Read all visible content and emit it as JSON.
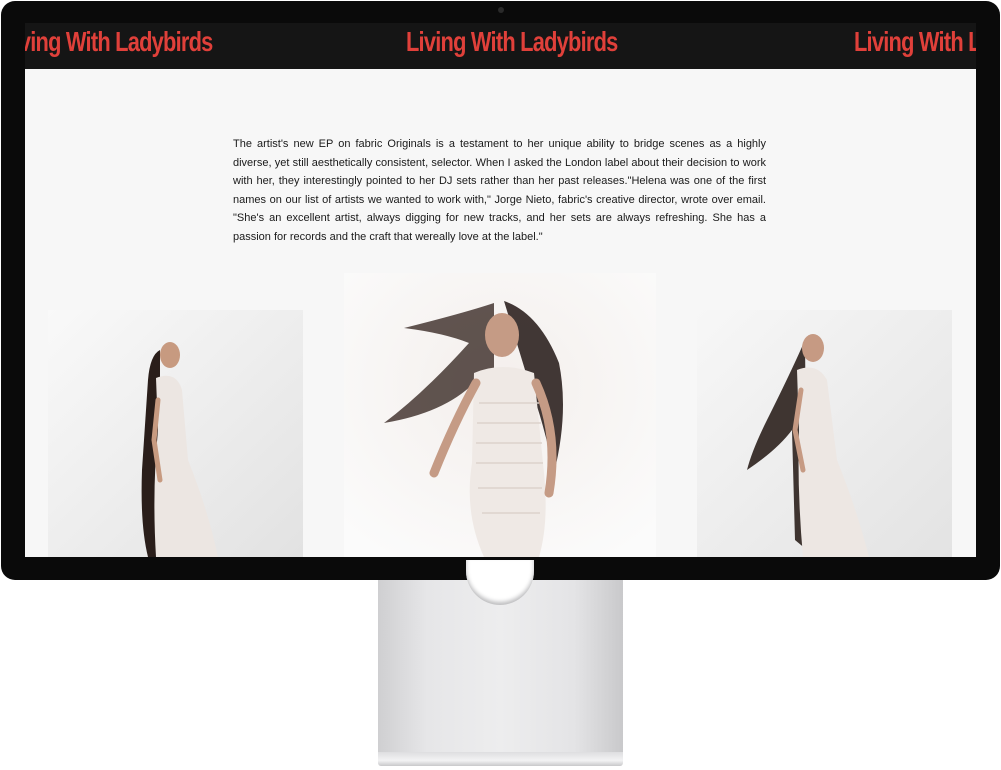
{
  "banner": {
    "items": [
      "Living With Ladybirds",
      "Living With Ladybirds",
      "Living With Ladybirds"
    ],
    "text_color": "#e0403a",
    "background": "#151515"
  },
  "article": {
    "paragraph": "The artist's new EP on fabric Originals is a testament to her unique ability to bridge scenes as a highly diverse, yet still aesthetically consistent, selector. When I asked the London label about their decision to work with her, they interestingly pointed to her DJ sets rather than her past releases.\"Helena was one of the first names on our list of artists we wanted to work with,\" Jorge Nieto, fabric's creative director, wrote over email. \"She's an excellent artist, always digging for new tracks, and her sets are always refreshing. She has a passion for records and the craft that wereally love at the label.\""
  },
  "colors": {
    "page_background": "#f7f7f7",
    "bezel": "#0a0a0a",
    "body_text": "#1a1a1a"
  }
}
